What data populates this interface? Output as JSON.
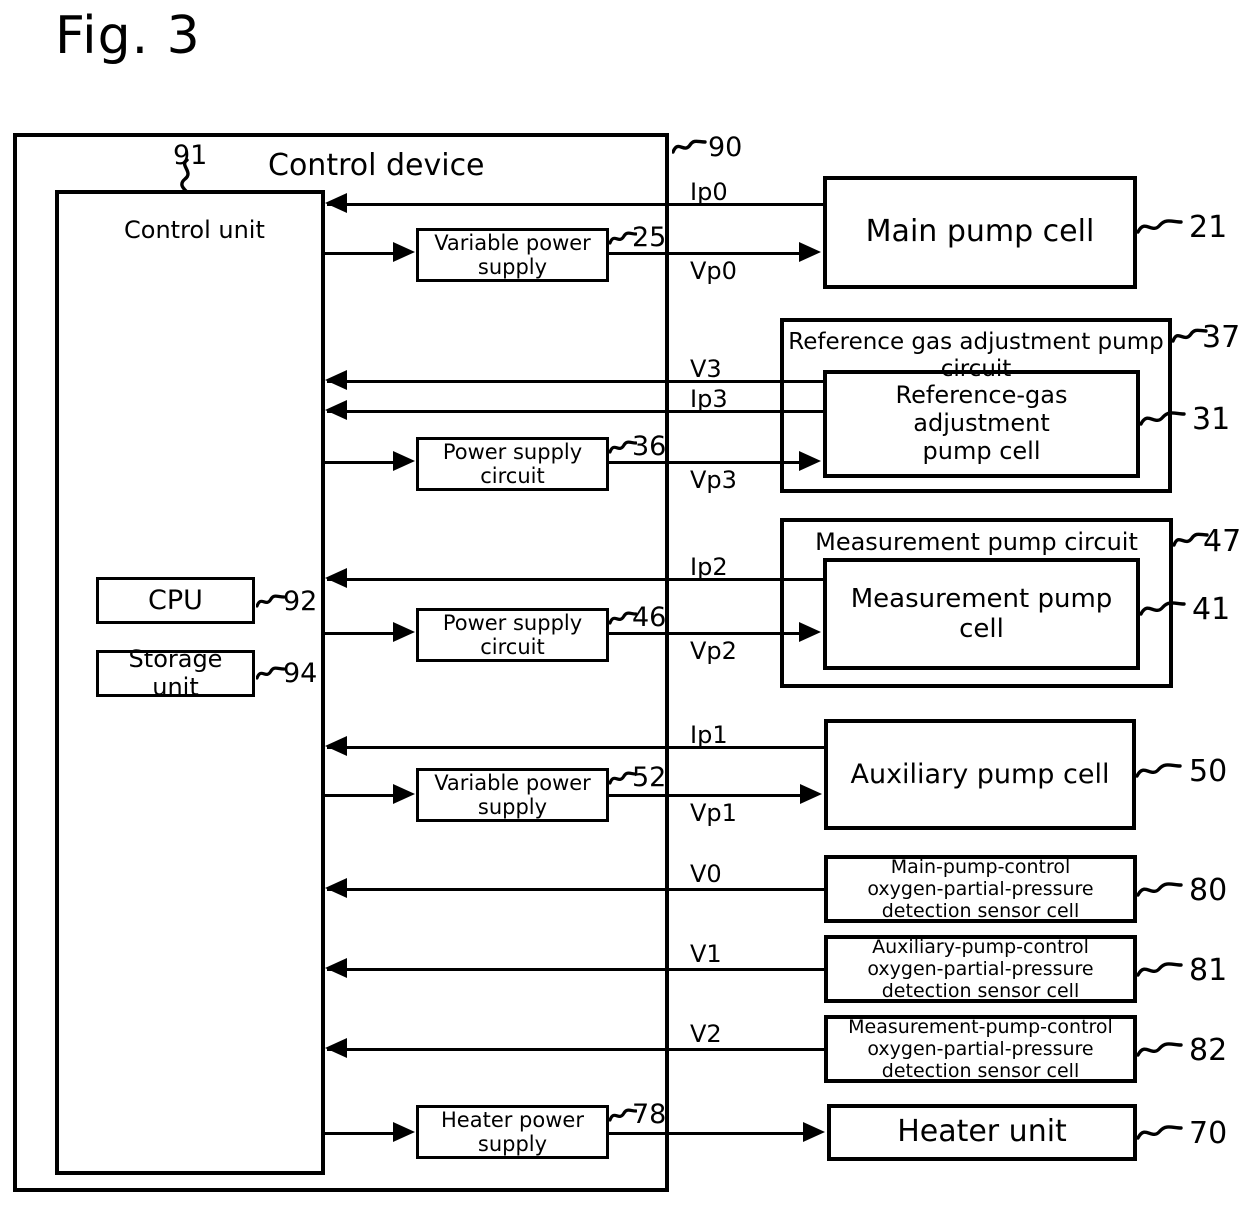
{
  "figure": {
    "title": "Fig. 3"
  },
  "control_device": {
    "title": "Control device",
    "ref": "90",
    "control_unit": {
      "label": "Control unit",
      "ref": "91",
      "cpu": {
        "label": "CPU",
        "ref": "92"
      },
      "storage": {
        "label": "Storage unit",
        "ref": "94"
      }
    },
    "supplies": [
      {
        "label": "Variable power\nsupply",
        "ref": "25"
      },
      {
        "label": "Power supply\ncircuit",
        "ref": "36"
      },
      {
        "label": "Power supply\ncircuit",
        "ref": "46"
      },
      {
        "label": "Variable power\nsupply",
        "ref": "52"
      },
      {
        "label": "Heater power\nsupply",
        "ref": "78"
      }
    ]
  },
  "signals": [
    {
      "name": "Ip0"
    },
    {
      "name": "Vp0"
    },
    {
      "name": "V3"
    },
    {
      "name": "Ip3"
    },
    {
      "name": "Vp3"
    },
    {
      "name": "Ip2"
    },
    {
      "name": "Vp2"
    },
    {
      "name": "Ip1"
    },
    {
      "name": "Vp1"
    },
    {
      "name": "V0"
    },
    {
      "name": "V1"
    },
    {
      "name": "V2"
    }
  ],
  "blocks": {
    "main_pump_cell": {
      "label": "Main pump cell",
      "ref": "21"
    },
    "reference_gas_circuit": {
      "label": "Reference gas adjustment pump circuit",
      "ref": "37"
    },
    "reference_gas_cell": {
      "label": "Reference-gas adjustment\npump cell",
      "ref": "31"
    },
    "measurement_circuit": {
      "label": "Measurement pump circuit",
      "ref": "47"
    },
    "measurement_cell": {
      "label": "Measurement pump cell",
      "ref": "41"
    },
    "auxiliary_pump_cell": {
      "label": "Auxiliary pump cell",
      "ref": "50"
    },
    "sensor_main": {
      "label": "Main-pump-control\noxygen-partial-pressure\ndetection sensor cell",
      "ref": "80"
    },
    "sensor_auxiliary": {
      "label": "Auxiliary-pump-control\noxygen-partial-pressure\ndetection sensor cell",
      "ref": "81"
    },
    "sensor_measurement": {
      "label": "Measurement-pump-control\noxygen-partial-pressure\ndetection sensor cell",
      "ref": "82"
    },
    "heater_unit": {
      "label": "Heater unit",
      "ref": "70"
    }
  },
  "colors": {
    "line": "#000000",
    "background": "#ffffff"
  }
}
